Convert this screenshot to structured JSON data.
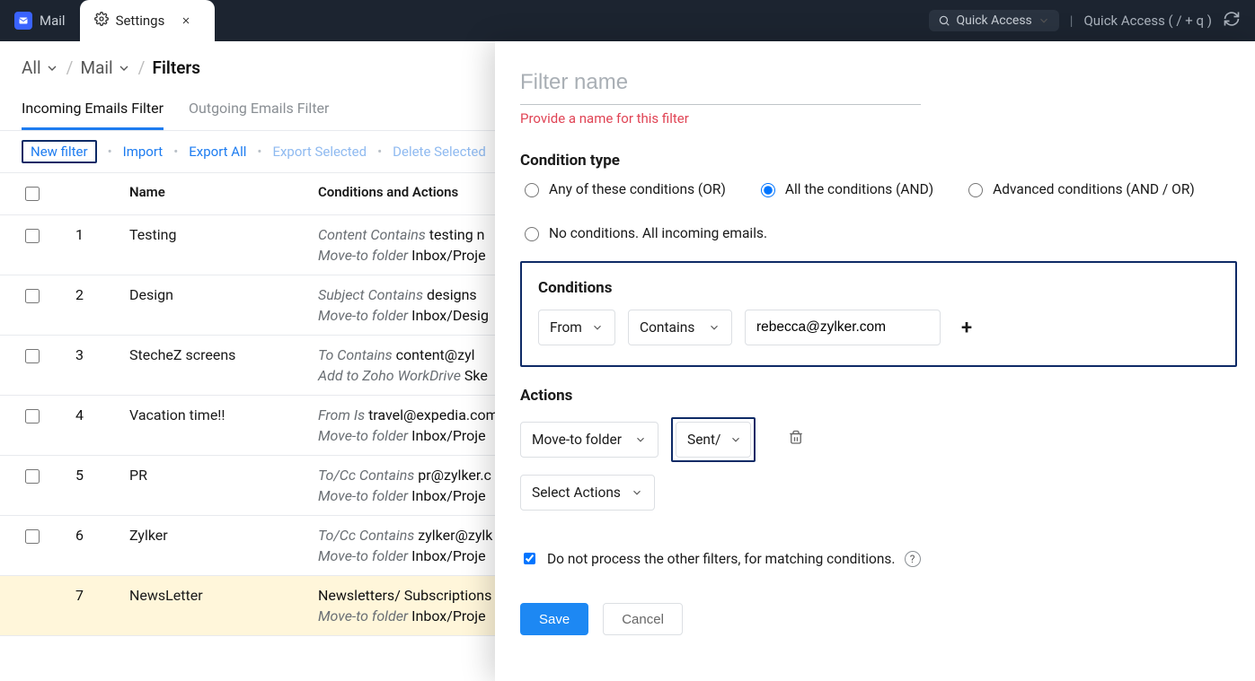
{
  "topbar": {
    "mail_label": "Mail",
    "settings_label": "Settings",
    "quick_pill": "Quick Access",
    "quick_right": "Quick Access  ( / + q )"
  },
  "breadcrumbs": {
    "all": "All",
    "mail": "Mail",
    "current": "Filters"
  },
  "filter_tabs": {
    "incoming": "Incoming Emails Filter",
    "outgoing": "Outgoing Emails Filter"
  },
  "actionbar": {
    "new": "New filter",
    "import": "Import",
    "export_all": "Export All",
    "export_selected": "Export Selected",
    "delete_selected": "Delete Selected"
  },
  "table": {
    "headers": {
      "name": "Name",
      "cond": "Conditions and Actions"
    },
    "rows": [
      {
        "n": "1",
        "name": "Testing",
        "l1_it": "Content Contains",
        "l1_v": "testing n",
        "l2_it": "Move-to folder",
        "l2_v": "Inbox/Proje"
      },
      {
        "n": "2",
        "name": "Design",
        "l1_it": "Subject Contains",
        "l1_v": "designs",
        "l2_it": "Move-to folder",
        "l2_v": "Inbox/Desig"
      },
      {
        "n": "3",
        "name": "StecheZ screens",
        "l1_it": "To Contains",
        "l1_v": "content@zyl",
        "l2_it": "Add to Zoho WorkDrive",
        "l2_v": "Ske"
      },
      {
        "n": "4",
        "name": "Vacation time!!",
        "l1_it": "From Is",
        "l1_v": "travel@expedia.com",
        "l2_it": "Move-to folder",
        "l2_v": "Inbox/Proje"
      },
      {
        "n": "5",
        "name": "PR",
        "l1_it": "To/Cc Contains",
        "l1_v": "pr@zylker.c",
        "l2_it": "Move-to folder",
        "l2_v": "Inbox/Proje"
      },
      {
        "n": "6",
        "name": "Zylker",
        "l1_it": "To/Cc Contains",
        "l1_v": "zylker@zylk",
        "l2_it": "Move-to folder",
        "l2_v": "Inbox/Proje"
      },
      {
        "n": "7",
        "name": "NewsLetter",
        "l1_it": "",
        "l1_v": "Newsletters/ Subscriptions",
        "l2_it": "Move-to folder",
        "l2_v": "Inbox/Proje"
      }
    ]
  },
  "panel": {
    "name_placeholder": "Filter name",
    "name_error": "Provide a name for this filter",
    "cond_type_title": "Condition type",
    "radios": {
      "any": "Any of these conditions (OR)",
      "all": "All the conditions (AND)",
      "adv": "Advanced conditions (AND / OR)",
      "none": "No conditions. All incoming emails."
    },
    "conditions_title": "Conditions",
    "cond_from": "From",
    "cond_contains": "Contains",
    "cond_value": "rebecca@zylker.com",
    "plus": "+",
    "actions_title": "Actions",
    "move_label": "Move-to folder",
    "folder_label": "Sent/",
    "select_actions": "Select Actions",
    "skip_label": "Do not process the other filters, for matching conditions.",
    "save": "Save",
    "cancel": "Cancel"
  }
}
